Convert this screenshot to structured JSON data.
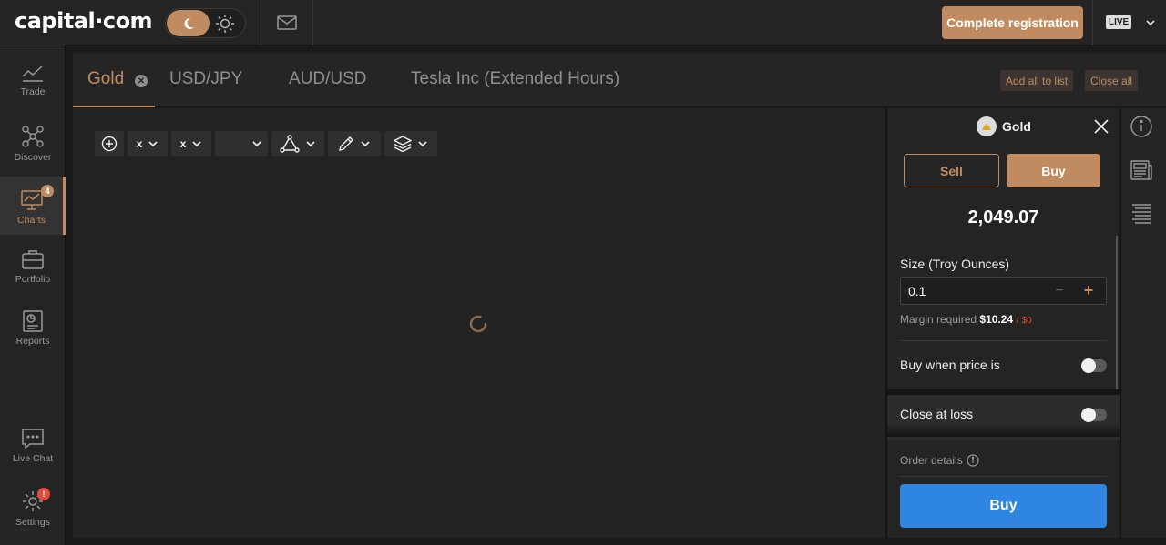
{
  "header": {
    "logo": "capital·com",
    "registration_button": "Complete registration",
    "account_mode": "LIVE"
  },
  "sidebar": {
    "items": [
      {
        "label": "Trade",
        "icon": "trade-chart-icon"
      },
      {
        "label": "Discover",
        "icon": "network-icon"
      },
      {
        "label": "Charts",
        "icon": "charts-monitor-icon",
        "badge": "4"
      },
      {
        "label": "Portfolio",
        "icon": "briefcase-icon"
      },
      {
        "label": "Reports",
        "icon": "report-icon"
      },
      {
        "label": "Live Chat",
        "icon": "chat-icon"
      },
      {
        "label": "Settings",
        "icon": "gear-icon",
        "badge": "!"
      }
    ]
  },
  "tabs": [
    {
      "label": "Gold",
      "active": true
    },
    {
      "label": "USD/JPY"
    },
    {
      "label": "AUD/USD"
    },
    {
      "label": "Tesla Inc (Extended Hours)"
    }
  ],
  "tab_actions": {
    "add_all": "Add all to list",
    "close_all": "Close all"
  },
  "toolbar": {
    "interval_1": "x",
    "interval_2": "x"
  },
  "trade_panel": {
    "asset": "Gold",
    "sell_label": "Sell",
    "buy_label": "Buy",
    "price": "2,049.07",
    "size_label": "Size (Troy Ounces)",
    "size_value": "0.1",
    "margin_label": "Margin required",
    "margin_value": "$10.24",
    "margin_available": "$0",
    "buy_when_label": "Buy when price is",
    "close_at_loss_label": "Close at loss",
    "order_details_label": "Order details",
    "submit_label": "Buy"
  },
  "colors": {
    "accent": "#c08b61",
    "buy_blue": "#2f86e0",
    "alert_red": "#e14b3b"
  }
}
